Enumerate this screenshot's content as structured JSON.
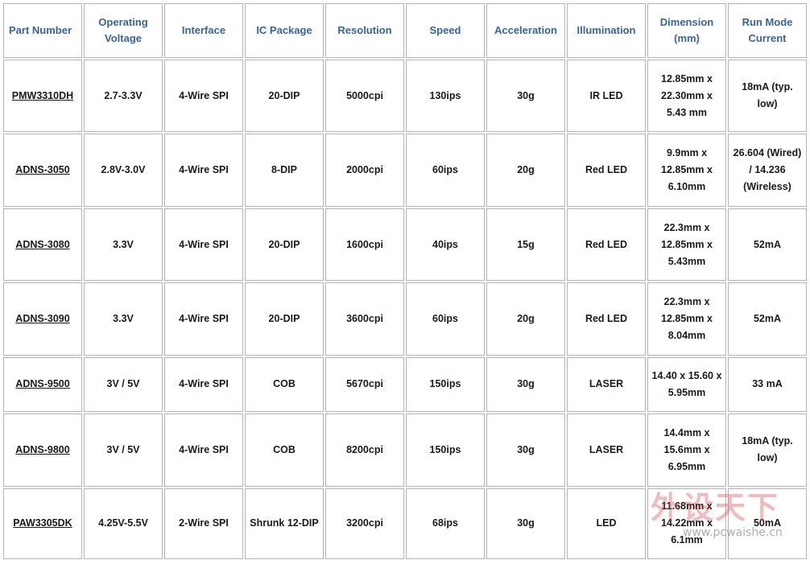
{
  "headers": [
    "Part Number",
    "Operating Voltage",
    "Interface",
    "IC Package",
    "Resolution",
    "Speed",
    "Acceleration",
    "Illumination",
    "Dimension (mm)",
    "Run Mode Current"
  ],
  "rows": [
    {
      "part": "PMW3310DH",
      "voltage": "2.7-3.3V",
      "interface": "4-Wire SPI",
      "package": "20-DIP",
      "resolution": "5000cpi",
      "speed": "130ips",
      "acceleration": "30g",
      "illumination": "IR LED",
      "dimension": "12.85mm x 22.30mm x 5.43 mm",
      "current": "18mA (typ. low)"
    },
    {
      "part": "ADNS-3050",
      "voltage": "2.8V-3.0V",
      "interface": "4-Wire SPI",
      "package": "8-DIP",
      "resolution": "2000cpi",
      "speed": "60ips",
      "acceleration": "20g",
      "illumination": "Red LED",
      "dimension": "9.9mm x 12.85mm x 6.10mm",
      "current": "26.604 (Wired) / 14.236 (Wireless)"
    },
    {
      "part": "ADNS-3080",
      "voltage": "3.3V",
      "interface": "4-Wire SPI",
      "package": "20-DIP",
      "resolution": "1600cpi",
      "speed": "40ips",
      "acceleration": "15g",
      "illumination": "Red LED",
      "dimension": "22.3mm x 12.85mm x 5.43mm",
      "current": "52mA"
    },
    {
      "part": "ADNS-3090",
      "voltage": "3.3V",
      "interface": "4-Wire SPI",
      "package": "20-DIP",
      "resolution": "3600cpi",
      "speed": "60ips",
      "acceleration": "20g",
      "illumination": "Red LED",
      "dimension": "22.3mm x 12.85mm x 8.04mm",
      "current": "52mA"
    },
    {
      "part": "ADNS-9500",
      "voltage": "3V / 5V",
      "interface": "4-Wire SPI",
      "package": "COB",
      "resolution": "5670cpi",
      "speed": "150ips",
      "acceleration": "30g",
      "illumination": "LASER",
      "dimension": "14.40 x 15.60 x 5.95mm",
      "current": "33 mA"
    },
    {
      "part": "ADNS-9800",
      "voltage": "3V / 5V",
      "interface": "4-Wire SPI",
      "package": "COB",
      "resolution": "8200cpi",
      "speed": "150ips",
      "acceleration": "30g",
      "illumination": "LASER",
      "dimension": "14.4mm x 15.6mm x 6.95mm",
      "current": "18mA (typ. low)"
    },
    {
      "part": "PAW3305DK",
      "voltage": "4.25V-5.5V",
      "interface": "2-Wire SPI",
      "package": "Shrunk 12-DIP",
      "resolution": "3200cpi",
      "speed": "68ips",
      "acceleration": "30g",
      "illumination": "LED",
      "dimension": "11.68mm x 14.22mm x 6.1mm",
      "current": "50mA"
    }
  ],
  "watermark": {
    "logo_text": "外设天下",
    "url": "www.pcwaishe.cn"
  },
  "colors": {
    "header_text": "#36649f",
    "border": "#b4b4b4",
    "body_text": "#1a1a1a"
  }
}
